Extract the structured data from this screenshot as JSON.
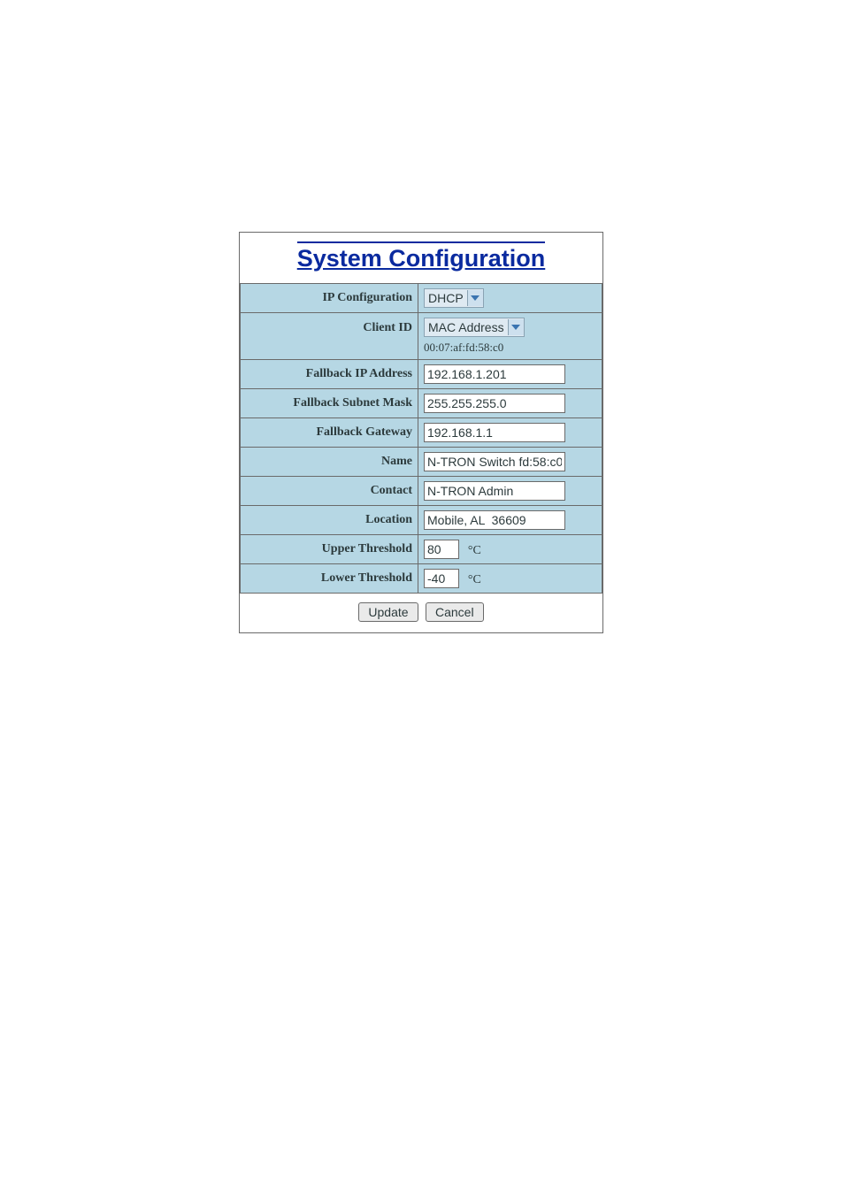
{
  "title": "System Configuration",
  "labels": {
    "ip_configuration": "IP Configuration",
    "client_id": "Client ID",
    "fallback_ip": "Fallback IP Address",
    "fallback_subnet": "Fallback Subnet Mask",
    "fallback_gateway": "Fallback Gateway",
    "name": "Name",
    "contact": "Contact",
    "location": "Location",
    "upper_threshold": "Upper Threshold",
    "lower_threshold": "Lower Threshold"
  },
  "values": {
    "ip_configuration_selected": "DHCP",
    "client_id_selected": "MAC Address",
    "client_id_mac": "00:07:af:fd:58:c0",
    "fallback_ip": "192.168.1.201",
    "fallback_subnet": "255.255.255.0",
    "fallback_gateway": "192.168.1.1",
    "name": "N-TRON Switch fd:58:c0",
    "contact": "N-TRON Admin",
    "location": "Mobile, AL  36609",
    "upper_threshold": "80",
    "lower_threshold": "-40",
    "temp_unit": "°C"
  },
  "buttons": {
    "update": "Update",
    "cancel": "Cancel"
  }
}
